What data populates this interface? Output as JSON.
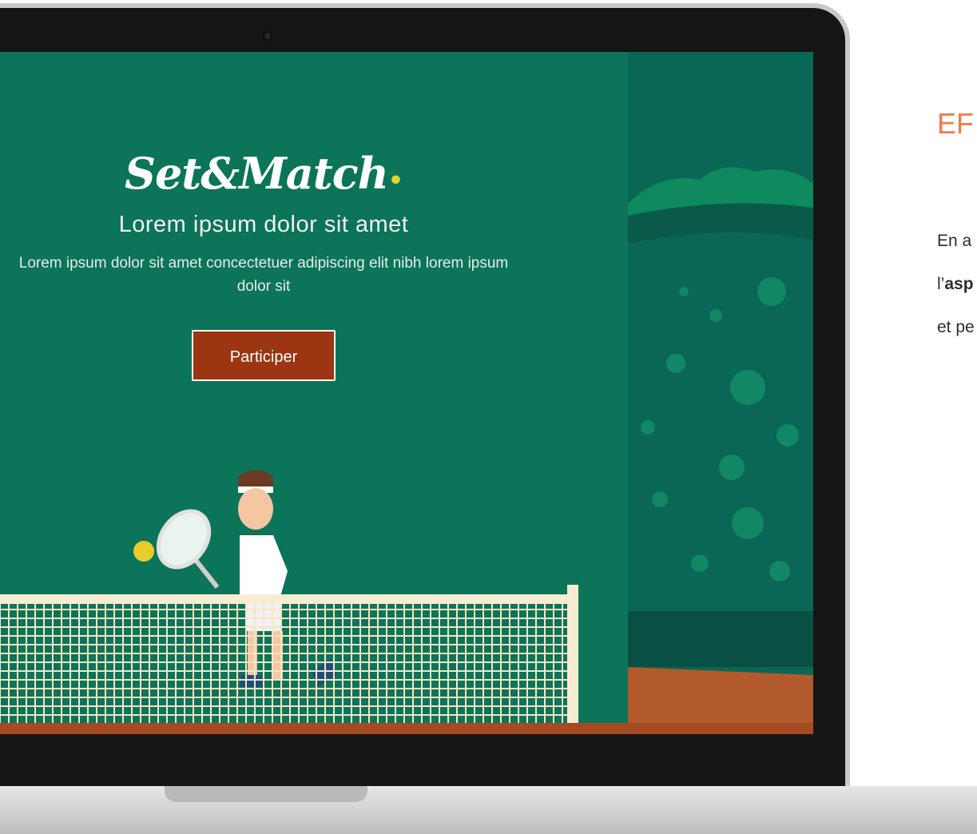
{
  "hero": {
    "logo": "Set&Match",
    "headline": "Lorem ipsum dolor sit amet",
    "subline": "Lorem ipsum dolor sit amet concectetuer adipiscing elit nibh lorem ipsum dolor sit",
    "cta_label": "Participer"
  },
  "side": {
    "title": "EF",
    "line1": "En a",
    "line2_prefix": "l’",
    "line2_bold": "asp",
    "line3": "et pe"
  },
  "colors": {
    "screen_green": "#0b7459",
    "cta_background": "#9b3512",
    "logo_dot": "#e2d52a",
    "side_title": "#f07a4a"
  },
  "icons": [
    "tennis-player-illustration",
    "tennis-net-illustration",
    "stadium-crowd-illustration"
  ]
}
